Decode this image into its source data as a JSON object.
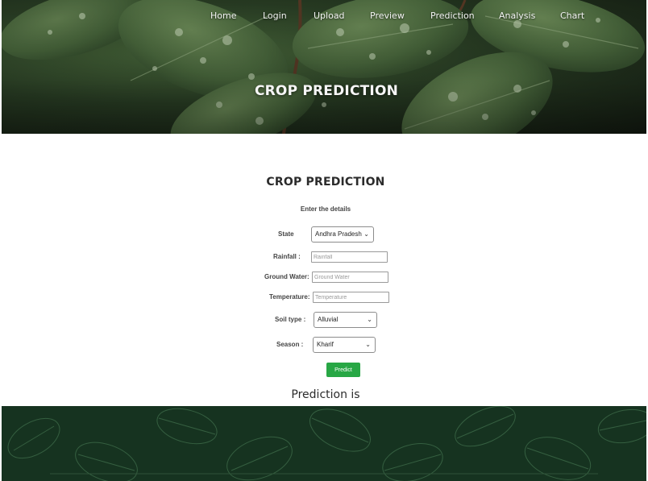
{
  "nav": {
    "items": [
      "Home",
      "Login",
      "Upload",
      "Preview",
      "Prediction",
      "Analysis",
      "Chart"
    ]
  },
  "hero": {
    "title": "CROP PREDICTION"
  },
  "form": {
    "title": "CROP PREDICTION",
    "subtitle": "Enter the details",
    "state": {
      "label": "State",
      "value": "Andhra Pradesh"
    },
    "rainfall": {
      "label": "Rainfall :",
      "placeholder": "Rainfall"
    },
    "ground_water": {
      "label": "Ground Water:",
      "placeholder": "Ground Water"
    },
    "temperature": {
      "label": "Temperature:",
      "placeholder": "Temperature"
    },
    "soil_type": {
      "label": "Soil type :",
      "value": "Alluvial"
    },
    "season": {
      "label": "Season :",
      "value": "Kharif"
    },
    "predict_button": "Predict"
  },
  "result": {
    "label": "Prediction is"
  },
  "colors": {
    "accent_button": "#28a745",
    "footer_bg": "#163320",
    "hero_dark": "#141c12"
  },
  "icons": [
    "chevron-down-icon",
    "leaf-photo-background",
    "leaf-pattern-background"
  ]
}
